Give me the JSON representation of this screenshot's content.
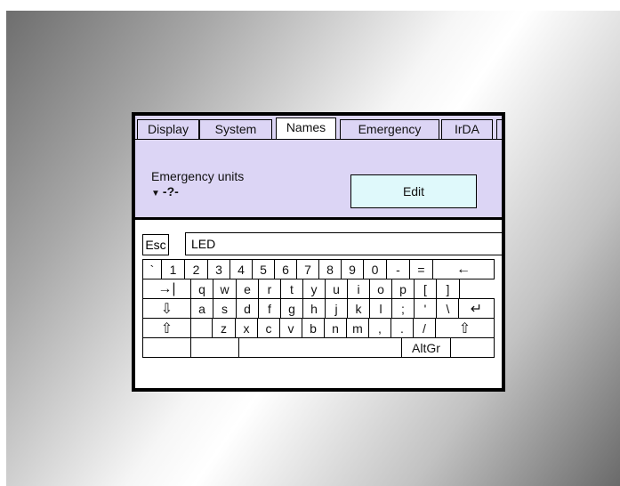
{
  "tabs": [
    {
      "label": "Display",
      "active": false
    },
    {
      "label": "System",
      "active": false
    },
    {
      "label": "Names",
      "active": true
    },
    {
      "label": "Emergency",
      "active": false
    },
    {
      "label": "IrDA",
      "active": false
    }
  ],
  "panel": {
    "label": "Emergency units",
    "value": "-?-",
    "dropdown_icon": "triangle-down-icon",
    "edit_label": "Edit"
  },
  "input": {
    "esc_label": "Esc",
    "value": "LED"
  },
  "keyboard": {
    "row1": [
      "`",
      "1",
      "2",
      "3",
      "4",
      "5",
      "6",
      "7",
      "8",
      "9",
      "0",
      "-",
      "=",
      "←"
    ],
    "row2": [
      "→|",
      "q",
      "w",
      "e",
      "r",
      "t",
      "y",
      "u",
      "i",
      "o",
      "p",
      "[",
      "]"
    ],
    "row3": [
      "⇩",
      "a",
      "s",
      "d",
      "f",
      "g",
      "h",
      "j",
      "k",
      "l",
      ";",
      "'",
      "\\",
      "↵"
    ],
    "row4": [
      "⇧",
      "z",
      "x",
      "c",
      "v",
      "b",
      "n",
      "m",
      ",",
      ".",
      "/",
      "⇧"
    ],
    "row5": [
      "AltGr"
    ],
    "icons": {
      "backspace": "backspace-arrow-icon",
      "tab": "tab-arrow-icon",
      "capslock": "capslock-arrow-icon",
      "enter": "enter-arrow-icon",
      "shift": "shift-arrow-icon"
    }
  },
  "colors": {
    "panel_bg": "#dcd5f5",
    "edit_bg": "#dff9fb",
    "frame": "#000000"
  }
}
